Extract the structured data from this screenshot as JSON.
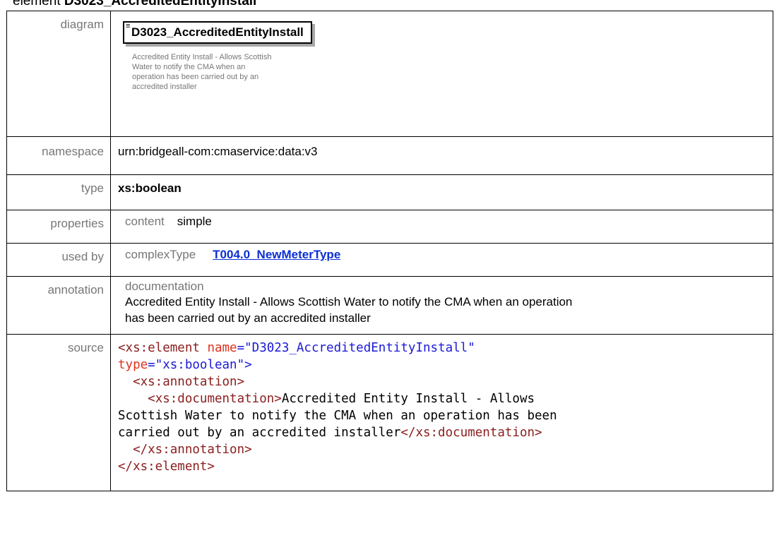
{
  "heading": {
    "prefix": "element ",
    "name": "D3023_AccreditedEntityInstall"
  },
  "rows": {
    "diagram": {
      "label": "diagram",
      "box_title": "D3023_AccreditedEntityInstall",
      "doc_lines": [
        "Accredited Entity Install - Allows Scottish",
        "Water to notify the CMA when an",
        "operation has been carried out by an",
        "accredited installer"
      ]
    },
    "namespace": {
      "label": "namespace",
      "value": "urn:bridgeall-com:cmaservice:data:v3"
    },
    "type": {
      "label": "type",
      "value": "xs:boolean"
    },
    "properties": {
      "label": "properties",
      "key": "content",
      "value": "simple"
    },
    "used_by": {
      "label": "used by",
      "key": "complexType",
      "link": "T004.0_NewMeterType"
    },
    "annotation": {
      "label": "annotation",
      "key": "documentation",
      "line1": "Accredited Entity Install - Allows Scottish Water to notify the CMA when an operation",
      "line2": "has been carried out by an accredited installer"
    },
    "source": {
      "label": "source",
      "l1_open": "<xs:element ",
      "l1_attr": "name",
      "l1_eq": "=",
      "l1_val": "\"D3023_AccreditedEntityInstall\"",
      "l2_attr": "type",
      "l2_eq": "=",
      "l2_val": "\"xs:boolean\"",
      "l2_close": ">",
      "l3": "<xs:annotation>",
      "l4_open": "<xs:documentation>",
      "l4_text": "Accredited Entity Install - Allows",
      "l5": "Scottish Water to notify the CMA when an operation has been",
      "l6_text": "carried out by an accredited installer",
      "l6_close": "</xs:documentation>",
      "l7": "</xs:annotation>",
      "l8": "</xs:element>"
    }
  }
}
